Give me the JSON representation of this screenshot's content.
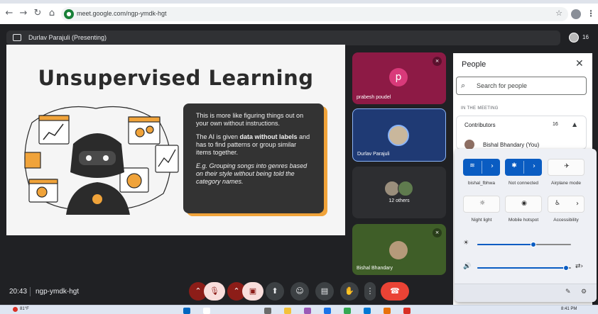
{
  "browser": {
    "url": "meet.google.com/ngp-ymdk-hgt"
  },
  "meeting": {
    "presenting_label": "Durlav Parajuli (Presenting)",
    "participant_count": "16",
    "time": "20:43",
    "code": "ngp-ymdk-hgt"
  },
  "slide": {
    "title": "Unsupervised Learning",
    "para1": "This is more like figuring things out on your own without instructions.",
    "para2_pre": "The AI is given ",
    "para2_bold": "data without labels",
    "para2_post": " and has to find patterns or group similar items together.",
    "para3": "E.g. Grouping songs into genres based on their style without being told the category names."
  },
  "tiles": [
    {
      "name": "prabesh poudel",
      "initial": "p",
      "bg": "#8d1a45",
      "avatar_color": "#d93a7a"
    },
    {
      "name": "Durlav Parajuli",
      "bg": "#1f3a74"
    },
    {
      "name": "12 others",
      "bg": "#2d2e31"
    },
    {
      "name": "Bishal Bhandary",
      "bg": "#3f5e28"
    }
  ],
  "people_panel": {
    "title": "People",
    "search_placeholder": "Search for people",
    "section_label": "IN THE MEETING",
    "contributors_label": "Contributors",
    "contributors_count": "16",
    "self_name": "Bishal Bhandary (You)"
  },
  "quick_settings": {
    "tiles": [
      {
        "label": "bishal_fbhwa",
        "icon": "wifi-icon",
        "state": "on"
      },
      {
        "label": "Not connected",
        "icon": "bluetooth-icon",
        "state": "on"
      },
      {
        "label": "Airplane mode",
        "icon": "airplane-icon",
        "state": "off"
      },
      {
        "label": "Night light",
        "icon": "night-light-icon",
        "state": "off"
      },
      {
        "label": "Mobile hotspot",
        "icon": "hotspot-icon",
        "state": "off"
      },
      {
        "label": "Accessibility",
        "icon": "accessibility-icon",
        "state": "off"
      }
    ],
    "brightness_level": 0.6,
    "volume_level": 0.95
  },
  "taskbar": {
    "temperature": "81°F",
    "time": "8:41 PM"
  },
  "colors": {
    "meet_bg": "#202124",
    "end_call": "#ea4335",
    "qs_accent": "#0a5cc2"
  }
}
